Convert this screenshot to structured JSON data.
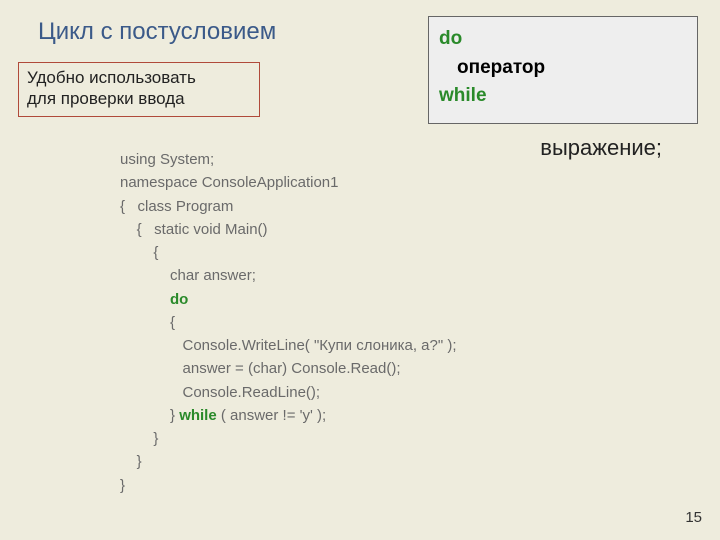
{
  "title": "Цикл с постусловием",
  "note": {
    "line1": "Удобно использовать",
    "line2": "для проверки ввода"
  },
  "syntax": {
    "do": "do",
    "operator": "оператор",
    "while": "while"
  },
  "expression": "выражение;",
  "code": {
    "l1": "using System;",
    "l2": "namespace ConsoleApplication1",
    "l3": "{   class Program",
    "l4": "    {   static void Main()",
    "l5": "        {",
    "l6": "            char answer;",
    "l7a": "            ",
    "l7kw": "do",
    "l8": "            {",
    "l9": "               Console.WriteLine( \"Купи слоника, а?\" );",
    "l10": "               answer = (char) Console.Read();",
    "l11": "               Console.ReadLine();",
    "l12a": "            } ",
    "l12kw": "while",
    "l12b": " ( answer != 'y' );",
    "l13": "        }",
    "l14": "    }",
    "l15": "}"
  },
  "page_number": "15"
}
